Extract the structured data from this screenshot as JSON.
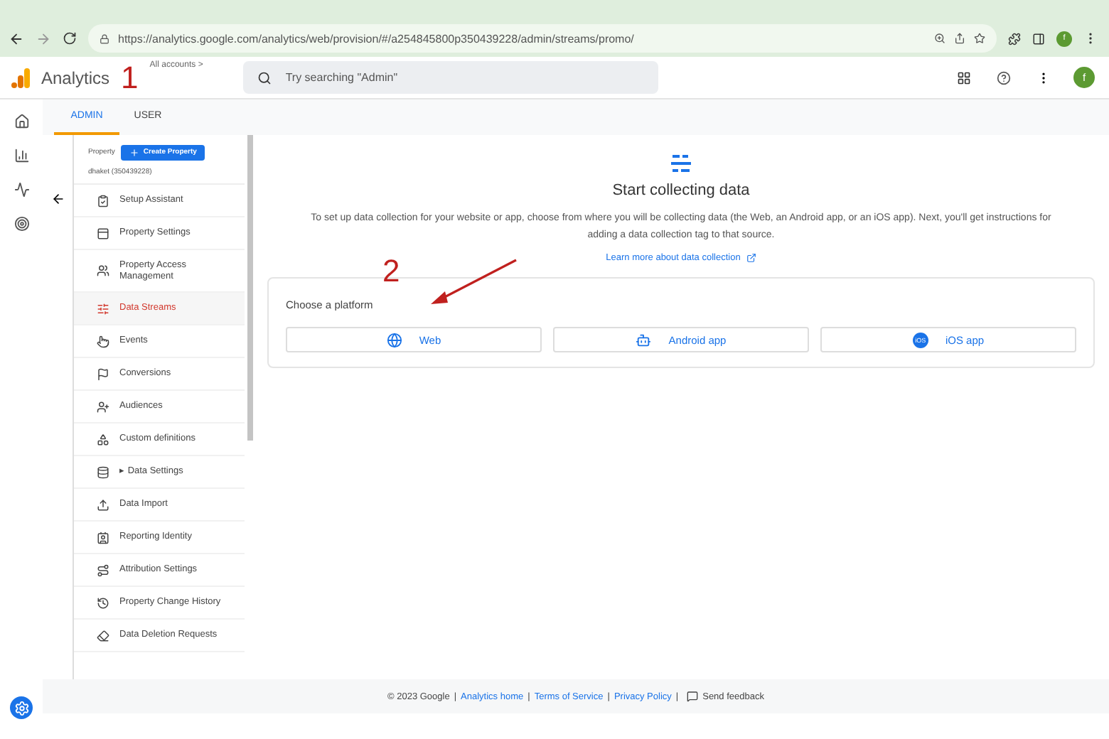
{
  "browser": {
    "url": "https://analytics.google.com/analytics/web/provision/#/a254845800p350439228/admin/streams/promo/",
    "profile": "f"
  },
  "header": {
    "product": "Analytics",
    "breadcrumb": "All accounts",
    "breadcrumb_caret": ">",
    "search": {
      "placeholder": "Try searching \"Admin\""
    },
    "avatar": "f"
  },
  "annotations": [
    {
      "text": "1"
    },
    {
      "text": "2"
    }
  ],
  "tabs": [
    {
      "label": "ADMIN",
      "selected": true
    },
    {
      "label": "USER",
      "selected": false
    }
  ],
  "property": {
    "label": "Property",
    "button": "Create Property",
    "name": "dhaket (350439228)"
  },
  "nav": [
    {
      "label": "Setup Assistant",
      "selected": false
    },
    {
      "label": "Property Settings",
      "selected": false
    },
    {
      "label": "Property Access Management",
      "selected": false
    },
    {
      "label": "Data Streams",
      "selected": true
    },
    {
      "label": "Events",
      "selected": false
    },
    {
      "label": "Conversions",
      "selected": false
    },
    {
      "label": "Audiences",
      "selected": false
    },
    {
      "label": "Custom definitions",
      "selected": false
    },
    {
      "label": "Data Settings",
      "selected": false,
      "caret": "▸"
    },
    {
      "label": "Data Import",
      "selected": false
    },
    {
      "label": "Reporting Identity",
      "selected": false
    },
    {
      "label": "Attribution Settings",
      "selected": false
    },
    {
      "label": "Property Change History",
      "selected": false
    },
    {
      "label": "Data Deletion Requests",
      "selected": false
    }
  ],
  "main": {
    "title": "Start collecting data",
    "description": "To set up data collection for your website or app, choose from where you will be collecting data (the Web, an Android app, or an iOS app). Next, you'll get instructions for adding a data collection tag to that source.",
    "link": "Learn more about data collection",
    "platform": {
      "title": "Choose a platform",
      "options": [
        {
          "label": "Web"
        },
        {
          "label": "Android app"
        },
        {
          "label": "iOS app",
          "badge": "iOS"
        }
      ]
    }
  },
  "footer": {
    "copyright": "© 2023 Google",
    "separator": "|",
    "links": [
      "Analytics home",
      "Terms of Service",
      "Privacy Policy"
    ],
    "feedback": "Send feedback"
  }
}
